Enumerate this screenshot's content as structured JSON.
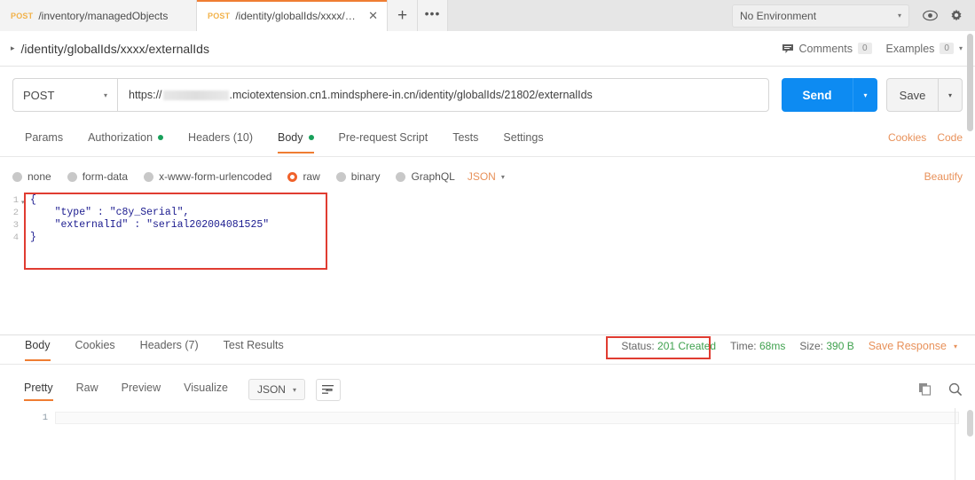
{
  "tabstrip": {
    "tabs": [
      {
        "method": "POST",
        "name": "/inventory/managedObjects",
        "active": false
      },
      {
        "method": "POST",
        "name": "/identity/globalIds/xxxx/exter...",
        "active": true
      }
    ],
    "close_glyph": "✕",
    "new_tab_label": "+",
    "more_tabs_label": "•••",
    "environment": {
      "label": "No Environment",
      "caret": "▾"
    },
    "eye_icon": "eye-icon",
    "settings_icon": "gear-icon"
  },
  "breadcrumb": {
    "caret": "▸",
    "title": "/identity/globalIds/xxxx/externalIds",
    "comments_label": "Comments",
    "comments_count": "0",
    "examples_label": "Examples",
    "examples_count": "0",
    "examples_caret": "▾"
  },
  "request": {
    "method": "POST",
    "method_caret": "▾",
    "url_prefix": "https://",
    "url_suffix": ".mciotextension.cn1.mindsphere-in.cn/identity/globalIds/21802/externalIds",
    "url_full": "https://[redacted].mciotextension.cn1.mindsphere-in.cn/identity/globalIds/21802/externalIds",
    "send_label": "Send",
    "send_caret": "▾",
    "save_label": "Save",
    "save_caret": "▾"
  },
  "request_tabs": {
    "items": [
      {
        "label": "Params",
        "dot": false,
        "active": false
      },
      {
        "label": "Authorization",
        "dot": true,
        "active": false
      },
      {
        "label": "Headers (10)",
        "dot": false,
        "active": false
      },
      {
        "label": "Body",
        "dot": true,
        "active": true
      },
      {
        "label": "Pre-request Script",
        "dot": false,
        "active": false
      },
      {
        "label": "Tests",
        "dot": false,
        "active": false
      },
      {
        "label": "Settings",
        "dot": false,
        "active": false
      }
    ],
    "cookies_link": "Cookies",
    "code_link": "Code"
  },
  "body_type": {
    "options": [
      {
        "label": "none",
        "selected": false
      },
      {
        "label": "form-data",
        "selected": false
      },
      {
        "label": "x-www-form-urlencoded",
        "selected": false
      },
      {
        "label": "raw",
        "selected": true
      },
      {
        "label": "binary",
        "selected": false
      },
      {
        "label": "GraphQL",
        "selected": false
      }
    ],
    "format": "JSON",
    "format_caret": "▾",
    "beautify_label": "Beautify"
  },
  "editor": {
    "line_numbers": [
      "1",
      "2",
      "3",
      "4"
    ],
    "fold_glyph": "▾",
    "lines": [
      "{",
      "    \"type\" : \"c8y_Serial\",",
      "    \"externalId\" : \"serial202004081525\"",
      "}"
    ],
    "content": "{\n    \"type\" : \"c8y_Serial\",\n    \"externalId\" : \"serial202004081525\"\n}"
  },
  "response": {
    "tabs": [
      {
        "label": "Body",
        "active": true
      },
      {
        "label": "Cookies",
        "active": false
      },
      {
        "label": "Headers (7)",
        "active": false
      },
      {
        "label": "Test Results",
        "active": false
      }
    ],
    "status_prefix": "Status:",
    "status_value": "201 Created",
    "time_prefix": "Time:",
    "time_value": "68ms",
    "size_prefix": "Size:",
    "size_value": "390 B",
    "save_response_label": "Save Response",
    "save_response_caret": "▾",
    "viewer_tabs": [
      {
        "label": "Pretty",
        "active": true
      },
      {
        "label": "Raw",
        "active": false
      },
      {
        "label": "Preview",
        "active": false
      },
      {
        "label": "Visualize",
        "active": false
      }
    ],
    "format": "JSON",
    "format_caret": "▾",
    "wrap_icon": "word-wrap-icon",
    "copy_icon": "copy-icon",
    "search_icon": "search-icon",
    "body_line_numbers": [
      "1"
    ],
    "body_lines": [
      ""
    ]
  },
  "annotations": {
    "body_highlight": "red-rectangle-around-request-body",
    "status_highlight": "red-rectangle-around-status"
  },
  "colors": {
    "accent_orange": "#ef7d32",
    "send_blue": "#0d8bf2",
    "status_green": "#3fa14e",
    "link_orange": "#e8915a",
    "annotation_red": "#e03c31",
    "method_yellow": "#f2b24a"
  }
}
